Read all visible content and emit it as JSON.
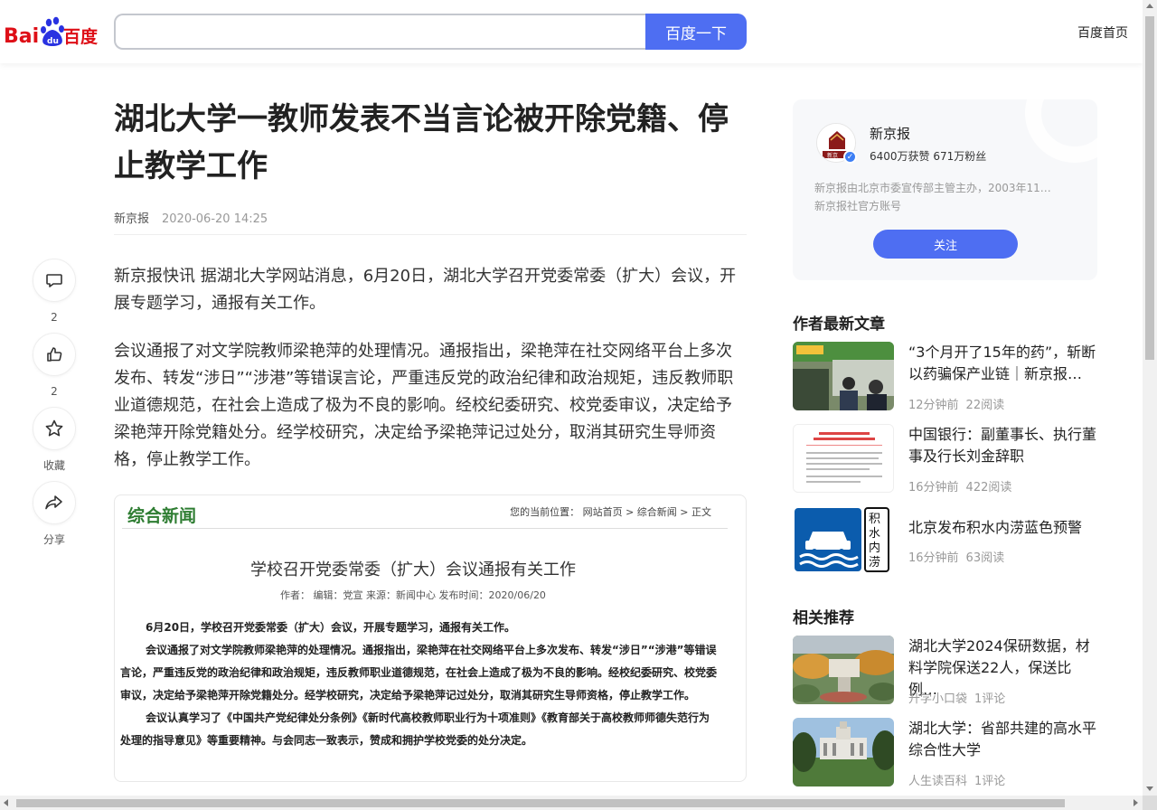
{
  "header": {
    "logo_text": "Bai百度",
    "search_placeholder": "",
    "search_button": "百度一下",
    "home_link": "百度首页"
  },
  "article": {
    "title": "湖北大学一教师发表不当言论被开除党籍、停止教学工作",
    "source": "新京报",
    "date": "2020-06-20 14:25",
    "paragraphs": [
      "新京报快讯 据湖北大学网站消息，6月20日，湖北大学召开党委常委（扩大）会议，开展专题学习，通报有关工作。",
      "会议通报了对文学院教师梁艳萍的处理情况。通报指出，梁艳萍在社交网络平台上多次发布、转发“涉日”“涉港”等错误言论，严重违反党的政治纪律和政治规矩，违反教师职业道德规范，在社会上造成了极为不良的影响。经校纪委研究、校党委审议，决定给予梁艳萍开除党籍处分。经学校研究，决定给予梁艳萍记过处分，取消其研究生导师资格，停止教学工作。"
    ]
  },
  "actions": {
    "comment": {
      "icon": "comment-icon",
      "label": "2"
    },
    "like": {
      "icon": "thumbs-up-icon",
      "label": "2"
    },
    "favorite": {
      "icon": "star-icon",
      "label": "收藏"
    },
    "share": {
      "icon": "share-icon",
      "label": "分享"
    }
  },
  "embed": {
    "section": "综合新闻",
    "breadcrumb": "您的当前位置： 网站首页  >  综合新闻  >  正文",
    "title": "学校召开党委常委（扩大）会议通报有关工作",
    "info": "作者：    编辑：党宣    来源：新闻中心   发布时间：2020/06/20",
    "body": [
      "6月20日，学校召开党委常委（扩大）会议，开展专题学习，通报有关工作。",
      "会议通报了对文学院教师梁艳萍的处理情况。通报指出，梁艳萍在社交网络平台上多次发布、转发“涉日”“涉港”等错误言论，严重违反党的政治纪律和政治规矩，违反教师职业道德规范，在社会上造成了极为不良的影响。经校纪委研究、校党委审议，决定给予梁艳萍开除党籍处分。经学校研究，决定给予梁艳萍记过处分，取消其研究生导师资格，停止教学工作。",
      "会议认真学习了《中国共产党纪律处分条例》《新时代高校教师职业行为十项准则》《教育部关于高校教师师德失范行为处理的指导意见》等重要精神。与会同志一致表示，赞成和拥护学校党委的处分决定。"
    ]
  },
  "author": {
    "name": "新京报",
    "stats": "6400万获赞 671万粉丝",
    "desc_line1": "新京报由北京市委宣传部主管主办，2003年11…",
    "desc_line2": "新京报社官方账号",
    "follow": "关注",
    "avatar_text": "新京"
  },
  "latest": {
    "title": "作者最新文章",
    "items": [
      {
        "title": "“3个月开了15年的药”，斩断以药骗保产业链｜新京报…",
        "time": "12分钟前",
        "reads": "22阅读"
      },
      {
        "title": "中国银行：副董事长、执行董事及行长刘金辞职",
        "time": "16分钟前",
        "reads": "422阅读"
      },
      {
        "title": "北京发布积水内涝蓝色预警",
        "time": "16分钟前",
        "reads": "63阅读",
        "thumb_text": "积水内涝"
      }
    ]
  },
  "related": {
    "title": "相关推荐",
    "items": [
      {
        "title": "湖北大学2024保研数据，材料学院保送22人，保送比例…",
        "source": "升学小口袋",
        "comments": "1评论"
      },
      {
        "title": "湖北大学：省部共建的高水平综合性大学",
        "source": "人生读百科",
        "comments": "1评论"
      }
    ]
  },
  "colors": {
    "accent": "#4e6ef2",
    "baidu_red": "#de0f17",
    "baidu_blue": "#2932e1",
    "section_green": "#2e7d32"
  }
}
